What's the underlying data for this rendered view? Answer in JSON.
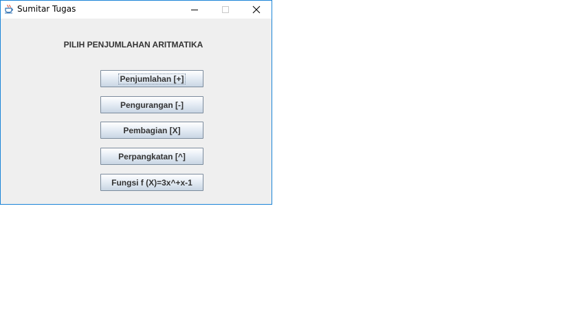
{
  "window": {
    "title": "Sumitar Tugas",
    "accent": "#1883d7"
  },
  "heading": "PILIH PENJUMLAHAN ARITMATIKA",
  "buttons": [
    {
      "label": "Penjumlahan [+]",
      "focused": true
    },
    {
      "label": "Pengurangan [-]"
    },
    {
      "label": "Pembagian [X]"
    },
    {
      "label": "Perpangkatan [^]"
    },
    {
      "label": "Fungsi f (X)=3x^+x-1"
    }
  ],
  "icons": {
    "app": "java-cup-icon",
    "minimize": "minimize-icon",
    "maximize": "maximize-icon",
    "close": "close-icon"
  }
}
